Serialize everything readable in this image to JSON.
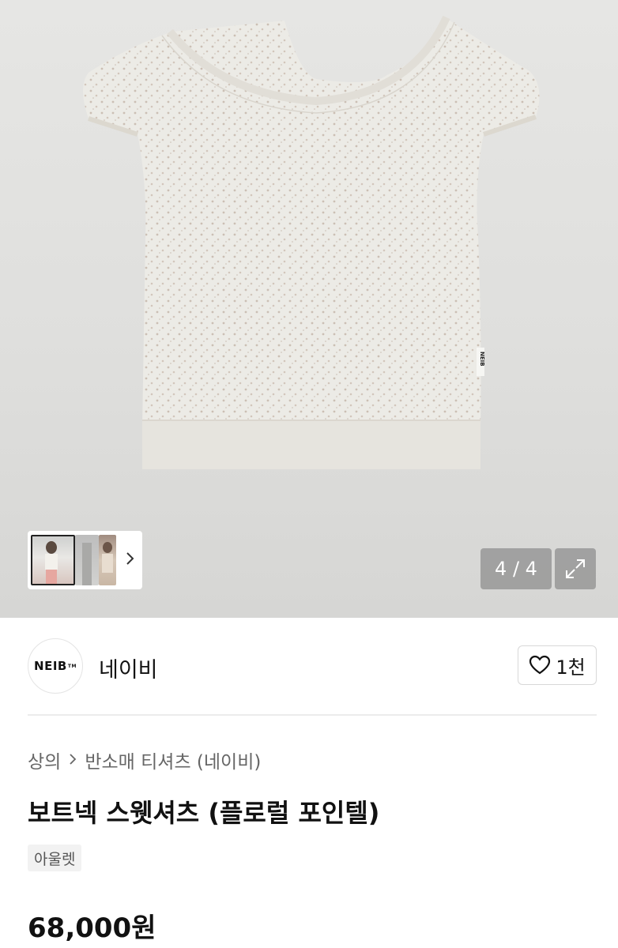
{
  "gallery": {
    "counter": "4 / 4",
    "next_icon": "chevron-right-icon",
    "expand_icon": "expand-arrows-icon",
    "product_label": "NEIB"
  },
  "brand": {
    "logo_text": "NEIB",
    "logo_tm": "TM",
    "name": "네이비",
    "like_count": "1천",
    "like_icon": "heart-outline-icon"
  },
  "breadcrumb": {
    "category": "상의",
    "subcategory": "반소매 티셔츠 (네이비)"
  },
  "product": {
    "title": "보트넥 스웻셔츠 (플로럴 포인텔)",
    "tag": "아울렛",
    "price": "68,000원"
  }
}
